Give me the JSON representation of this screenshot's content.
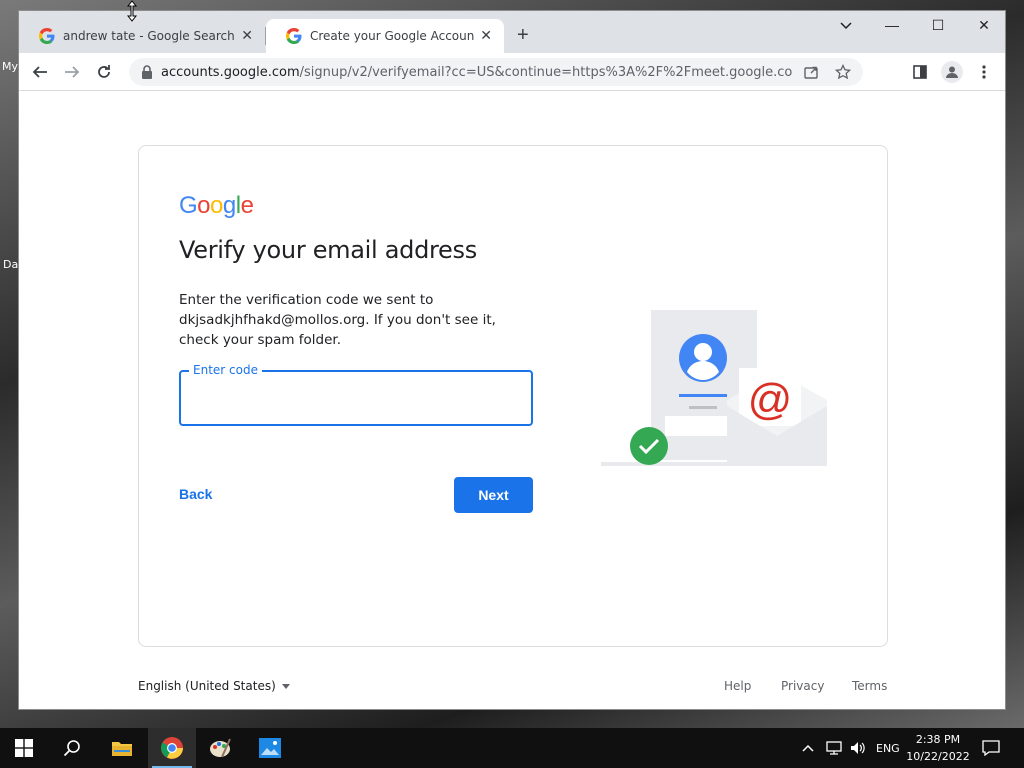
{
  "desktop": {
    "labels": [
      "My",
      "Da"
    ]
  },
  "browser": {
    "tabs": [
      {
        "title": "andrew tate - Google Search",
        "active": false
      },
      {
        "title": "Create your Google Account",
        "active": true
      }
    ],
    "window_controls": {
      "minimize": "—",
      "maximize": "☐",
      "close": "✕"
    },
    "url": {
      "host": "accounts.google.com",
      "path": "/signup/v2/verifyemail?cc=US&continue=https%3A%2F%2Fmeet.google.com%2Fne..."
    }
  },
  "page": {
    "logo": "Google",
    "heading": "Verify your email address",
    "description": "Enter the verification code we sent to dkjsadkjhfhakd@mollos.org. If you don't see it, check your spam folder.",
    "code_field": {
      "label": "Enter code",
      "value": ""
    },
    "back_label": "Back",
    "next_label": "Next",
    "footer": {
      "language": "English (United States)",
      "links": [
        "Help",
        "Privacy",
        "Terms"
      ]
    }
  },
  "taskbar": {
    "language": "ENG",
    "time": "2:38 PM",
    "date": "10/22/2022"
  },
  "colors": {
    "accent": "#1a73e8",
    "success": "#34a853",
    "at_sign": "#d93025"
  }
}
